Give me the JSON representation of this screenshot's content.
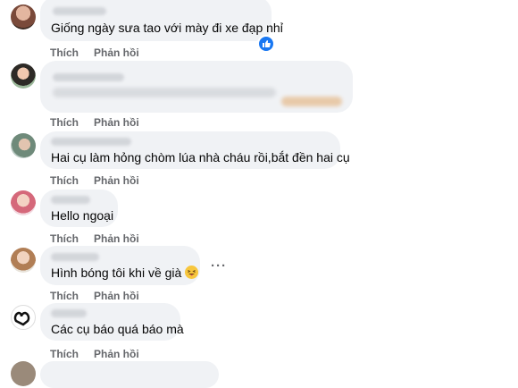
{
  "actions": {
    "like": "Thích",
    "reply": "Phản hồi"
  },
  "comments": [
    {
      "text": "Giống ngày sưa tao với mày đi xe đạp nhỉ",
      "reaction": "like-icon"
    },
    {
      "text": ""
    },
    {
      "text": "Hai cụ làm hỏng chòm lúa nhà cháu rồi,bắt đền hai cụ"
    },
    {
      "text": "Hello ngoại"
    },
    {
      "text": "Hình bóng tôi khi về già",
      "emoji": "laughing-tongue-emoji"
    },
    {
      "text": "Các cụ báo quá báo mà"
    }
  ],
  "more_menu": "···"
}
